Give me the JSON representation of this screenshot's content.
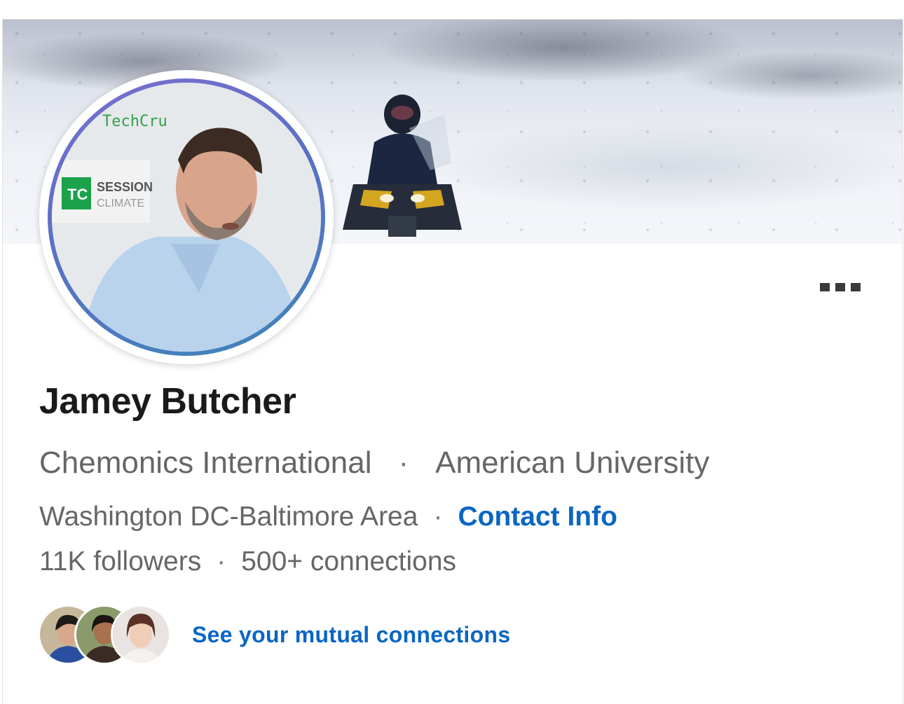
{
  "profile": {
    "name": "Jamey Butcher",
    "company": "Chemonics International",
    "separator": "·",
    "school": "American University",
    "location": "Washington DC-Baltimore Area",
    "contact_label": "Contact Info",
    "followers": "11K followers",
    "connections": "500+ connections"
  },
  "mutual": {
    "link_label": "See your mutual connections"
  },
  "icons": {
    "more": "more-options-icon"
  },
  "colors": {
    "link": "#0a66c2",
    "ring_start": "#7a6fd0",
    "ring_end": "#3d86b8"
  }
}
